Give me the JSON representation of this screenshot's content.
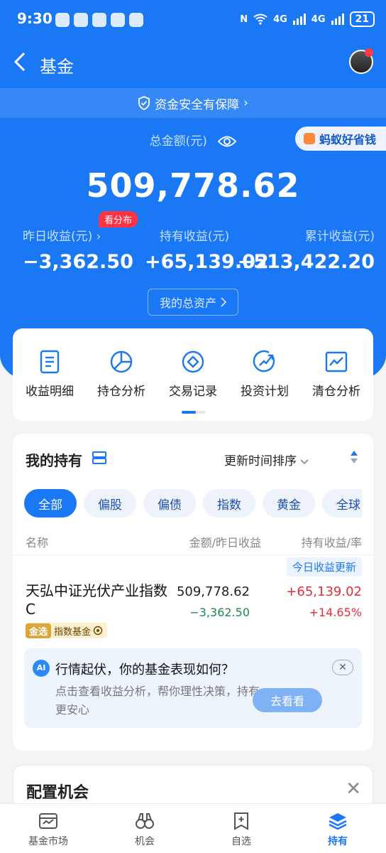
{
  "status_bar": {
    "time": "9:30",
    "network": "4G",
    "network2": "4G",
    "battery": "21"
  },
  "nav": {
    "back_icon": "chevron-left-icon",
    "title": "基金"
  },
  "safety_banner": {
    "text": "资金安全有保障",
    "chevron": "›"
  },
  "summary": {
    "total_label": "总金额(元)",
    "total_amount": "509,778.62",
    "promo_label": "蚂蚁好省钱",
    "distribution_badge": "看分布",
    "stats": [
      {
        "label": "昨日收益(元)",
        "chevron": "›",
        "value": "−3,362.50"
      },
      {
        "label": "持有收益(元)",
        "value": "+65,139.02"
      },
      {
        "label": "累计收益(元)",
        "value": "+513,422.20"
      }
    ],
    "assets_button": "我的总资产"
  },
  "tools": [
    {
      "label": "收益明细",
      "icon": "document-icon"
    },
    {
      "label": "持仓分析",
      "icon": "pie-chart-icon"
    },
    {
      "label": "交易记录",
      "icon": "record-icon"
    },
    {
      "label": "投资计划",
      "icon": "trend-icon"
    },
    {
      "label": "清仓分析",
      "icon": "chart-icon"
    }
  ],
  "holdings": {
    "title": "我的持有",
    "sort_label": "更新时间排序",
    "chips": [
      "全部",
      "偏股",
      "偏债",
      "指数",
      "黄金",
      "全球"
    ],
    "active_chip": "全部",
    "columns": {
      "name": "名称",
      "amount": "金额/昨日收益",
      "profit": "持有收益/率"
    },
    "update_tag": "今日收益更新",
    "fund": {
      "name": "天弘中证光伏产业指数C",
      "tag_gold": "金选",
      "tag_text": "指数基金",
      "amount": "509,778.62",
      "yesterday": "−3,362.50",
      "profit": "+65,139.02",
      "rate": "+14.65%"
    },
    "ai_card": {
      "logo": "AI",
      "title": "行情起伏，你的基金表现如何？",
      "desc": "点击查看收益分析，帮你理性决策，持有更安心",
      "button": "去看看",
      "close": "✕"
    }
  },
  "config": {
    "title": "配置机会",
    "close": "✕"
  },
  "tabbar": [
    {
      "label": "基金市场",
      "icon": "market-icon"
    },
    {
      "label": "机会",
      "icon": "binoculars-icon"
    },
    {
      "label": "自选",
      "icon": "add-bookmark-icon"
    },
    {
      "label": "持有",
      "icon": "layers-icon",
      "active": true
    }
  ],
  "colors": {
    "primary": "#1a78f5",
    "loss": "#1c8a4e",
    "gain": "#e52e3c",
    "badge": "#ff3346"
  }
}
